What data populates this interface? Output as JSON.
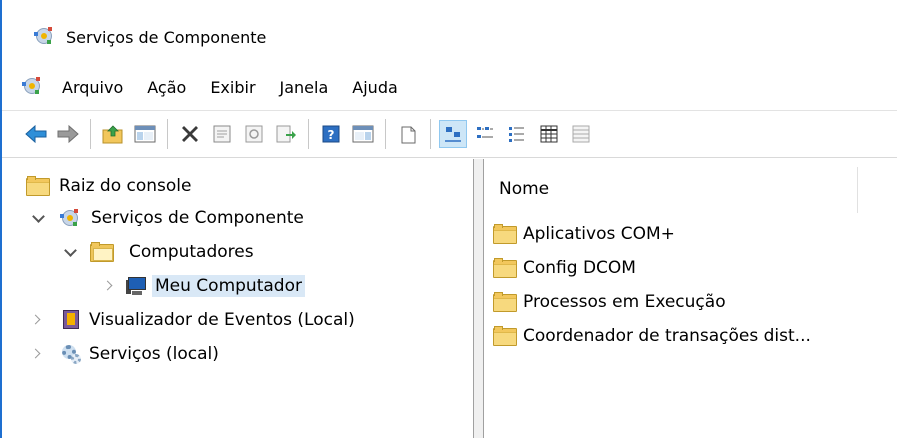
{
  "window": {
    "title": "Serviços de Componente",
    "accent": "#1e6fd0"
  },
  "menu": {
    "items": [
      "Arquivo",
      "Ação",
      "Exibir",
      "Janela",
      "Ajuda"
    ]
  },
  "toolbar": {
    "buttons": [
      {
        "icon": "arrow-left-icon"
      },
      {
        "icon": "arrow-right-icon"
      },
      {
        "icon": "up-folder-icon"
      },
      {
        "icon": "show-hide-tree-icon"
      },
      {
        "icon": "delete-icon"
      },
      {
        "icon": "properties-icon"
      },
      {
        "icon": "refresh-icon"
      },
      {
        "icon": "export-list-icon"
      },
      {
        "icon": "help-icon"
      },
      {
        "icon": "show-action-pane-icon"
      },
      {
        "icon": "new-window-icon"
      },
      {
        "icon": "large-icons-view-icon"
      },
      {
        "icon": "small-icons-view-icon"
      },
      {
        "icon": "list-view-icon"
      },
      {
        "icon": "detail-view-icon"
      },
      {
        "icon": "status-view-icon"
      }
    ]
  },
  "tree": {
    "items": [
      {
        "label": "Raiz do console",
        "icon": "folder-icon"
      },
      {
        "label": "Serviços de Componente",
        "icon": "component-services-icon"
      },
      {
        "label": "Computadores",
        "icon": "open-folder-icon"
      },
      {
        "label": "Meu Computador",
        "icon": "computer-icon",
        "selected": true
      },
      {
        "label": "Visualizador de Eventos (Local)",
        "icon": "event-viewer-icon"
      },
      {
        "label": "Serviços (local)",
        "icon": "services-gear-icon"
      }
    ]
  },
  "list": {
    "column": "Nome",
    "items": [
      {
        "label": "Aplicativos COM+"
      },
      {
        "label": "Config DCOM"
      },
      {
        "label": "Processos em Execução"
      },
      {
        "label": "Coordenador de transações dist..."
      }
    ]
  }
}
